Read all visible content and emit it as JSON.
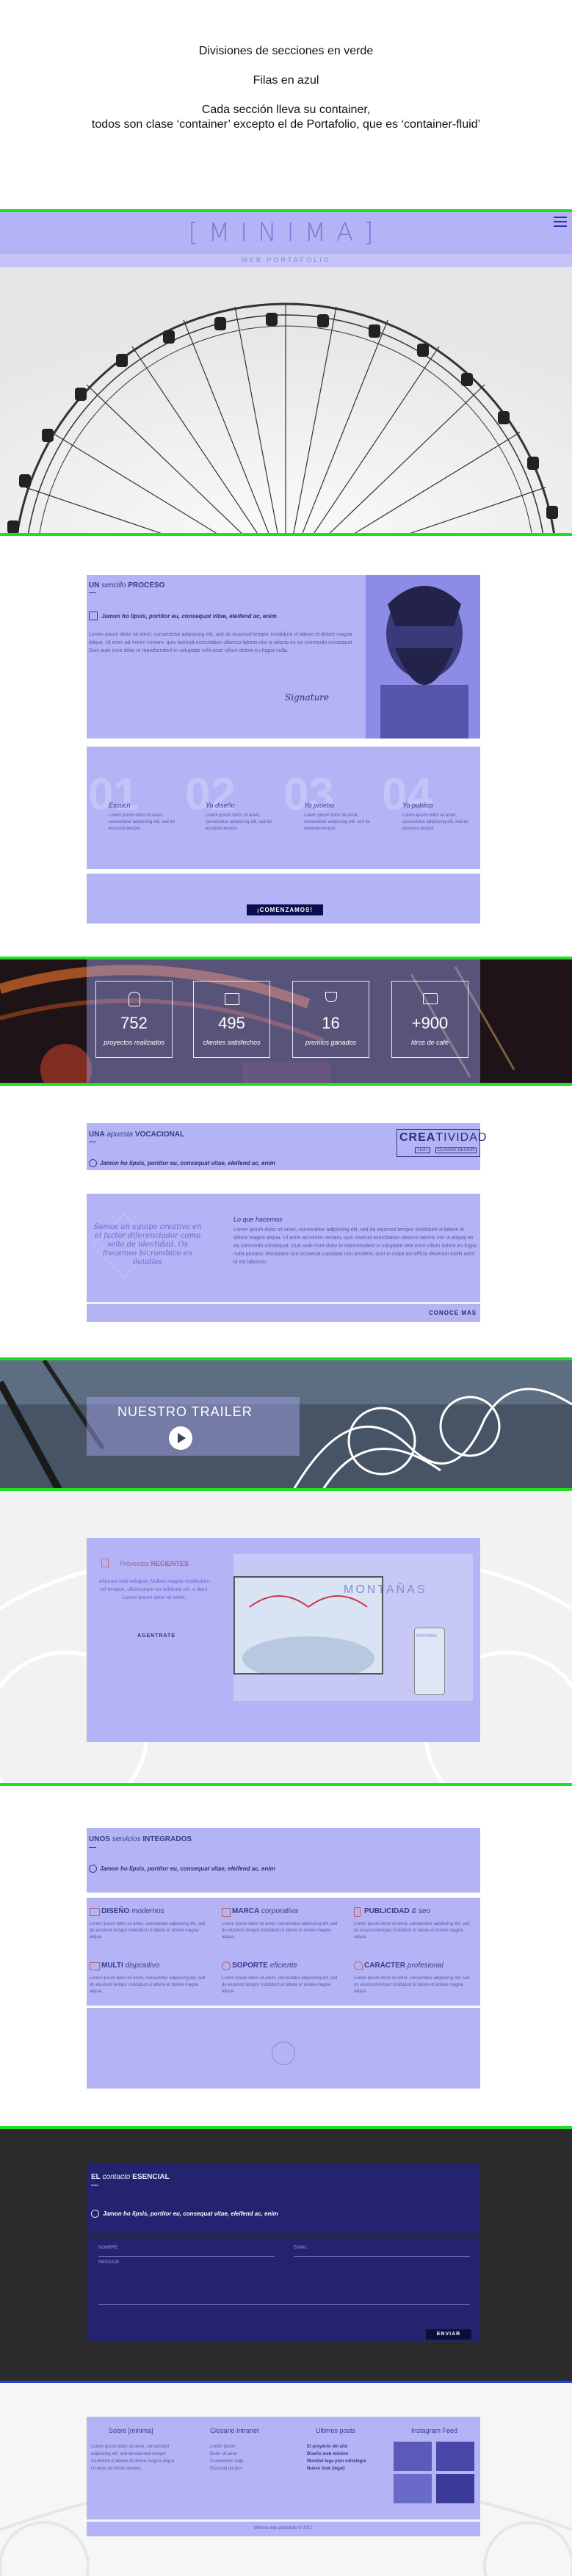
{
  "notes": {
    "line1": "Divisiones de secciones en verde",
    "line2": "Filas en azul",
    "line3": "Cada sección lleva su container,",
    "line4": "todos son clase ‘container’ excepto el de Portafolio, que es ‘container-fluid’"
  },
  "nav": {
    "logo": "[MINIMA]",
    "tagline": "WEB PORTAFOLIO",
    "menu_icon": "hamburger-icon"
  },
  "process": {
    "title_a": "UN",
    "title_b": "sencillo",
    "title_c": "PROCESO",
    "tagline": "Jamon ho lipsis, portitor eu, consequat vitae, eleifend ac, enim",
    "body": "Lorem ipsum dolor sit amet, consectetur adipiscing elit, sed do eiusmod tempor incididunt ut labore et dolore magna aliqua. Ut enim ad minim veniam, quis nostrud exercitation ullamco laboris nisi ut aliquip ex ea commodo consequat. Duis aute irure dolor in reprehenderit in voluptate velit esse cillum dolore eu fugiat nulla.",
    "signature": "Signature",
    "steps": [
      {
        "num": "01",
        "title": "Escuch",
        "text": "Lorem ipsum dolor sit amet, consectetur adipiscing elit, sed do eiusmod tempor."
      },
      {
        "num": "02",
        "title": "Yo diseño",
        "text": "Lorem ipsum dolor sit amet, consectetur adipiscing elit, sed do eiusmod tempor."
      },
      {
        "num": "03",
        "title": "Yo pruebo",
        "text": "Lorem ipsum dolor sit amet, consectetur adipiscing elit, sed do eiusmod tempor."
      },
      {
        "num": "04",
        "title": "Yo publico",
        "text": "Lorem ipsum dolor sit amet, consectetur adipiscing elit, sed do eiusmod tempor."
      }
    ],
    "cta": "¡COMENZAMOS!"
  },
  "stats": [
    {
      "value": "752",
      "label": "proyectos realizados",
      "icon": "lightbulb-icon"
    },
    {
      "value": "495",
      "label": "clientes satisfechos",
      "icon": "chart-icon"
    },
    {
      "value": "16",
      "label": "premios ganados",
      "icon": "trophy-icon"
    },
    {
      "value": "+900",
      "label": "litros de café",
      "icon": "camera-icon"
    }
  ],
  "vocation": {
    "title_a": "UNA",
    "title_b": "apuesta",
    "title_c": "VOCACIONAL",
    "tagline": "Jamon ho lipsis, portitor eu, consequat vitae, eleifend ac, enim",
    "badge_a": "CREA",
    "badge_b": "TIVIDAD",
    "badge_sub1": "TEXT",
    "badge_sub2": "CLASSIC DESIGN",
    "quote": "Somos un equipo creativo en el factor diferenciador como sello de identidad. Os frecemos bicrombico en detalles",
    "subtitle": "Lo que hacemos",
    "body": "Lorem ipsum dolor sit amet, consectetur adipiscing elit, sed do eiusmod tempor incididunt ut labore et dolore magna aliqua. Ut enim ad minim veniam, quis nostrud exercitation ullamco laboris nisi ut aliquip ex ea commodo consequat. Duis aute irure dolor in reprehenderit in voluptate velit esse cillum dolore eu fugiat nulla pariatur. Excepteur sint occaecat cupidatat non proident, sunt in culpa qui officia deserunt mollit anim id est laborum.",
    "more": "CONOCE MAS"
  },
  "trailer": {
    "title": "NUESTRO TRAILER"
  },
  "projects": {
    "title_a": "Proyectos",
    "title_b": "RECIENTES",
    "text": "Aliquam erat volutpat. Nullam magna vestibulum vel tempus, ullamcorper eu vehicula vel, a liberi. Lorem ipsum dolor sit amet.",
    "button": "AGENTRATE",
    "mock_title": "MONTAÑAS",
    "mock_small": "MONTAÑAS"
  },
  "services": {
    "title_a": "UNOS",
    "title_b": "servicios",
    "title_c": "INTEGRADOS",
    "tagline": "Jamon ho lipsis, portitor eu, consequat vitae, eleifend ac, enim",
    "items": [
      {
        "name": "DISEÑO",
        "sub": "modernos",
        "icon": "monitor-icon"
      },
      {
        "name": "MARCA",
        "sub": "corporativa",
        "icon": "tag-icon"
      },
      {
        "name": "PUBLICIDAD",
        "sub": "& seo",
        "icon": "phone-icon"
      },
      {
        "name": "MULTI",
        "sub": "dispositivo",
        "icon": "devices-icon"
      },
      {
        "name": "SOPORTE",
        "sub": "eficiente",
        "icon": "gear-icon"
      },
      {
        "name": "CARÁCTER",
        "sub": "profesional",
        "icon": "heart-icon"
      }
    ],
    "item_text": "Lorem ipsum dolor sit amet, consectetur adipiscing elit, sed do eiusmod tempor incididunt ut labore et dolore magna aliqua."
  },
  "contact": {
    "title_a": "EL",
    "title_b": "contacto",
    "title_c": "ESENCIAL",
    "tagline": "Jamon ho lipsis, portitor eu, consequat vitae, eleifend ac, enim",
    "name_placeholder": "NOMBRE",
    "email_placeholder": "EMAIL",
    "message_placeholder": "MENSAJE",
    "submit": "ENVIAR"
  },
  "footer": {
    "col1_title": "Sobre [minima]",
    "col1_text": "Lorem ipsum dolor sit amet, consectetur adipiscing elit, sed do eiusmod tempor incididunt ut labore et dolore magna aliqua. Ut enim ad minim veniam.",
    "col2_title": "Glosario Intranet",
    "col2_items": [
      "Lorem ipsum",
      "Dolor sit amet",
      "Consectetur adip",
      "Eiusmod tempor"
    ],
    "col3_title": "Ultimos posts",
    "col3_items": [
      "El proyecto del año",
      "Diseño web mínimo",
      "Mundial lega plan estrategia",
      "Nuevo look (legal)"
    ],
    "col4_title": "Instagram Feed",
    "copyright": "Minima web portafolio © 2017"
  }
}
